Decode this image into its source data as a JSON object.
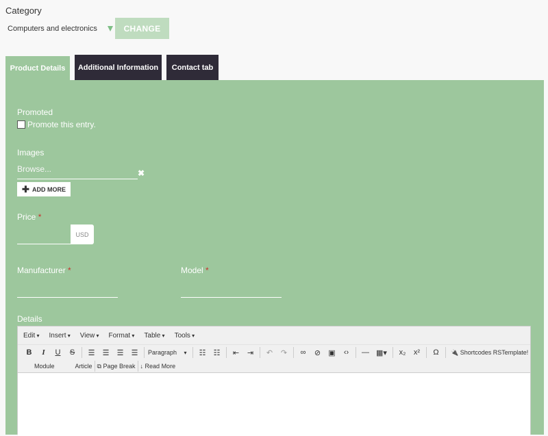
{
  "category": {
    "label": "Category",
    "selected": "Computers and electronics",
    "change_label": "CHANGE"
  },
  "tabs": [
    {
      "label": "Product Details",
      "active": true
    },
    {
      "label": "Additional Information",
      "active": false
    },
    {
      "label": "Contact tab",
      "active": false
    }
  ],
  "form": {
    "promoted_label": "Promoted",
    "promote_checkbox_label": "Promote this entry.",
    "images_label": "Images",
    "browse_placeholder": "Browse...",
    "add_more_label": "ADD MORE",
    "price_label": "Price",
    "currency": "USD",
    "manufacturer_label": "Manufacturer",
    "model_label": "Model",
    "details_label": "Details",
    "required_mark": "*"
  },
  "editor": {
    "menus": [
      "Edit",
      "Insert",
      "View",
      "Format",
      "Table",
      "Tools"
    ],
    "format_select": "Paragraph",
    "shortcodes_label": "Shortcodes RSTemplate!",
    "module_label": "Module",
    "article_label": "Article",
    "page_break_label": "Page Break",
    "read_more_label": "Read More"
  },
  "colors": {
    "panel": "#9dc79d",
    "dark_tab": "#2f2b38",
    "change_button": "#bfdcbf",
    "required": "#c9302c"
  }
}
